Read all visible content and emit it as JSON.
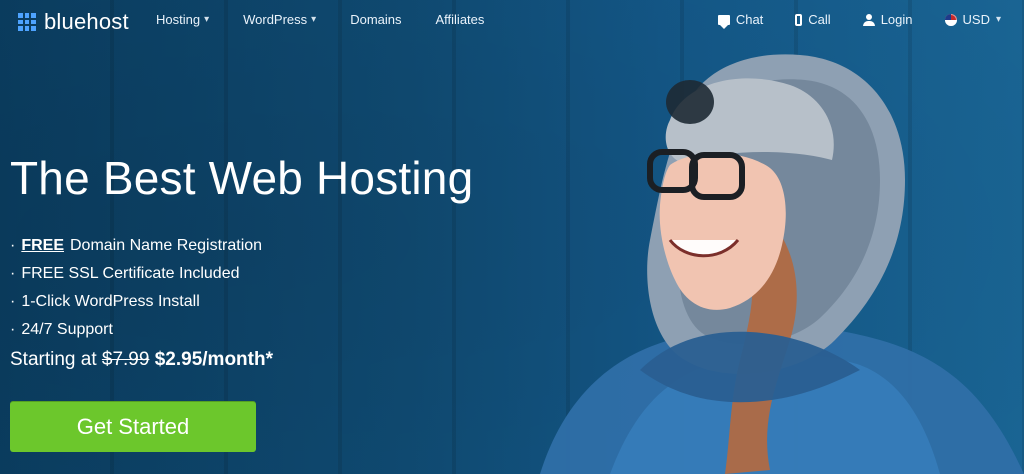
{
  "brand": {
    "name": "bluehost",
    "logo": "grid-icon"
  },
  "nav": {
    "left": [
      {
        "label": "Hosting",
        "has_caret": true
      },
      {
        "label": "WordPress",
        "has_caret": true
      },
      {
        "label": "Domains",
        "has_caret": false
      },
      {
        "label": "Affiliates",
        "has_caret": false
      }
    ],
    "right": [
      {
        "label": "Chat",
        "icon": "chat-icon"
      },
      {
        "label": "Call",
        "icon": "phone-icon"
      },
      {
        "label": "Login",
        "icon": "user-icon"
      },
      {
        "label": "USD",
        "icon": "flag-icon",
        "has_caret": true
      }
    ]
  },
  "hero": {
    "title": "The Best Web Hosting",
    "bullets": [
      {
        "prefix": "·",
        "emph": "FREE",
        "text": " Domain Name Registration"
      },
      {
        "prefix": "·",
        "text": "FREE SSL Certificate Included"
      },
      {
        "prefix": "·",
        "text": "1-Click WordPress Install"
      },
      {
        "prefix": "·",
        "text": "24/7 Support"
      }
    ],
    "price": {
      "label": "Starting at",
      "old": "$7.99",
      "new": "$2.95/month*"
    },
    "cta": "Get Started"
  },
  "colors": {
    "accent": "#6cc72c",
    "brand_blue": "#4ea3ff"
  }
}
